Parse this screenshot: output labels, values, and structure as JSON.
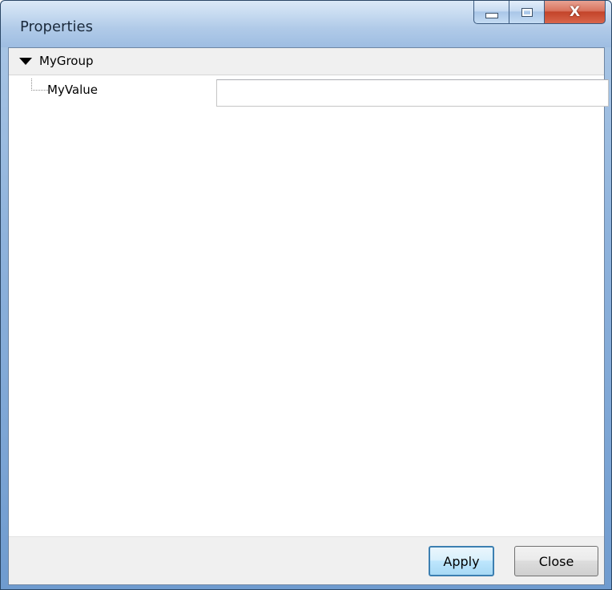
{
  "window": {
    "title": "Properties"
  },
  "caption_buttons": {
    "minimize_icon": "minimize-icon",
    "maximize_icon": "maximize-icon",
    "close_label": "X"
  },
  "property_grid": {
    "group": {
      "label": "MyGroup",
      "expanded": true,
      "icon": "expanded-triangle-icon"
    },
    "properties": [
      {
        "name": "MyValue",
        "value": ""
      }
    ]
  },
  "footer": {
    "apply_label": "Apply",
    "close_label": "Close"
  },
  "colors": {
    "titlebar": "#c6daf0",
    "close_button": "#c3442a",
    "default_button_border": "#3c7fb1",
    "panel_background": "#f0f0f0"
  }
}
